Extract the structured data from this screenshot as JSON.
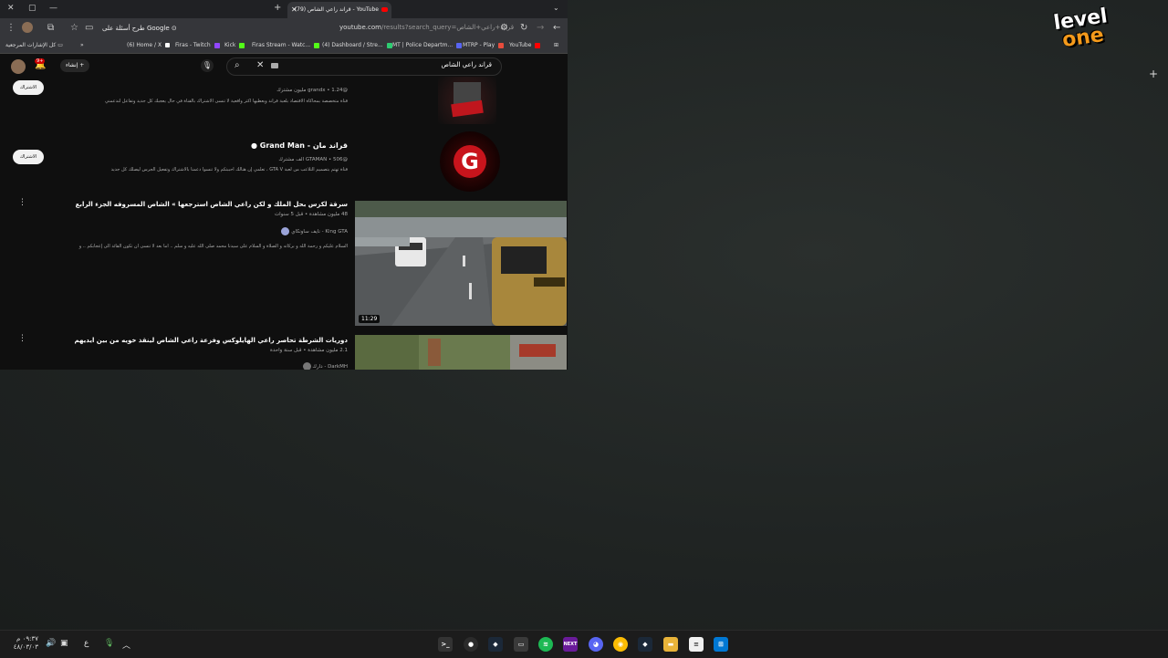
{
  "browser": {
    "tab_title": "(79) قراند راعي الشاص - YouTube",
    "url_host": "youtube.com",
    "url_path": "/results?search_query=قراند+راعي+الشاص",
    "lens_chip": "طرح أسئلة على Google",
    "bookmarks": [
      {
        "label": "(6) Home / X",
        "color": "#000000"
      },
      {
        "label": "Firas - Twitch",
        "color": "#9146ff"
      },
      {
        "label": "Kick",
        "color": "#53fc18"
      },
      {
        "label": "Firas Stream - Watc...",
        "color": "#53fc18"
      },
      {
        "label": "(4) Dashboard / Stre...",
        "color": "#2ecc71"
      },
      {
        "label": "MT | Police Departm...",
        "color": "#5865f2"
      },
      {
        "label": "MTRP - Play",
        "color": "#e74c3c"
      },
      {
        "label": "YouTube",
        "color": "#ff0000"
      }
    ],
    "all_bookmarks": "كل الإشارات المرجعية"
  },
  "youtube": {
    "search_query": "قراند راعي الشاص",
    "create_label": "إنشاء",
    "notif_count": "9+",
    "subscribe_label": "الاشتراك",
    "channels": [
      {
        "name": "",
        "handle_meta": "@grandx • 1.24 مليون مشترك",
        "description": "قناة متخصصة بمحاكاة الاقتصاد بلعبة قراند ويعطيها أكثر واقعية لا تنسى الاشتراك بالقناة في حال يعجبك كل جديد وتفاعل لندعمني"
      },
      {
        "name": "قراند مان - Grand Man",
        "handle_meta": "@GTAMAN • 506 ألف مشترك",
        "description": "قناة تهتم بتصميم التلاعب من لعبة GTA V ، تعلمي إن هنالك أحببتكم ولا تنسوا دعمنا بالاشتراك وتفعيل الجرس ليصلك كل جديد"
      }
    ],
    "videos": [
      {
        "title": "سرقة لكزس بحل الملك و لكن راعي الشاص استرجعها » الشاص المسروقه الجزء الرابع » قراند 5",
        "meta": "48 مليون مشاهدة • قبل 5 سنوات",
        "channel": "King GTA - نايف ساونكاي",
        "description": "السلام عليكم و رحمة الله و بركاته و الصلاة و السلام على سيدنا محمد صلى الله عليه و سلم .. اما بعد لا تنسى أن تكون القائد الى إعجابكم .. و",
        "duration": "11:29"
      },
      {
        "title": "دوريات الشرطة تحاصر راعي الهايلوكس وفزعة راعي الشاص لينقذ خويه من بين ايديهم | فلم قراند 5",
        "meta": "2.1 مليون مشاهدة • قبل سنة واحدة",
        "channel": "DarkMH - دارك",
        "description": "",
        "duration": ""
      }
    ]
  },
  "taskbar": {
    "time": "٠٩:٣٧ م",
    "date": "٤٨/٠٣/٠٣",
    "lang": "ع"
  },
  "desktop": {
    "logo_line1": "level",
    "logo_line2": "one"
  }
}
